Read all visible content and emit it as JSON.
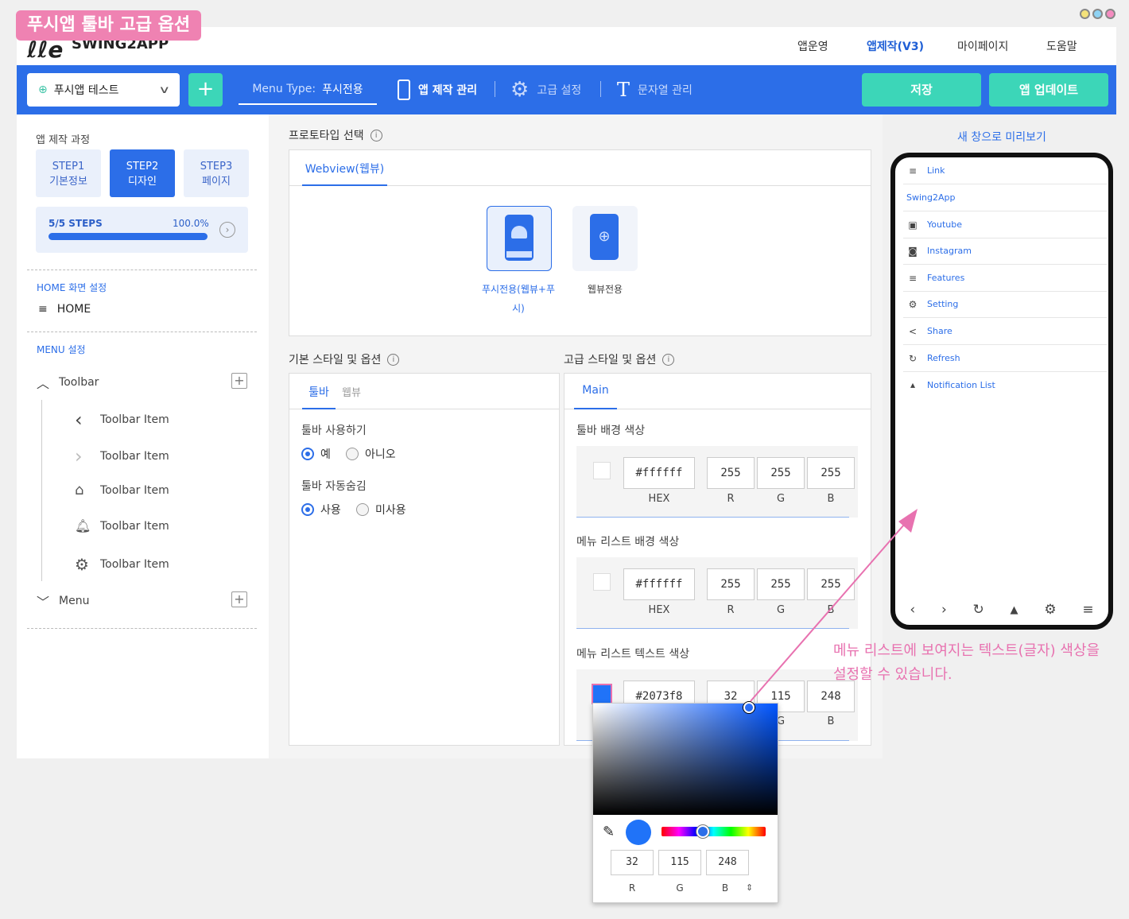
{
  "badge": "푸시앱 툴바 고급 옵션",
  "header": {
    "logo": "SWING2APP",
    "nav": [
      "앱운영",
      "앱제작(V3)",
      "마이페이지",
      "도움말"
    ]
  },
  "toolbar": {
    "app_name": "푸시앱 테스트",
    "plus": "+",
    "menu_type_label": "Menu Type:",
    "menu_type_value": "푸시전용",
    "app_manage": "앱 제작 관리",
    "advanced": "고급 설정",
    "strings": "문자열 관리",
    "save": "저장",
    "update": "앱 업데이트"
  },
  "sidebar": {
    "process_title": "앱 제작 과정",
    "steps": [
      {
        "top": "STEP1",
        "bottom": "기본정보"
      },
      {
        "top": "STEP2",
        "bottom": "디자인"
      },
      {
        "top": "STEP3",
        "bottom": "페이지"
      }
    ],
    "progress_label": "5/5 STEPS",
    "progress_value": "100.0%",
    "progress_fraction": 1.0,
    "home_title": "HOME 화면 설정",
    "home_item": "HOME",
    "menu_title": "MENU 설정",
    "toolbar_group": "Toolbar",
    "toolbar_items": [
      "Toolbar Item",
      "Toolbar Item",
      "Toolbar Item",
      "Toolbar Item",
      "Toolbar Item"
    ],
    "toolbar_item_icons": [
      "chevron-left-icon",
      "chevron-right-icon",
      "home-icon",
      "bell-icon",
      "gear-icon"
    ],
    "menu_group": "Menu"
  },
  "prototype": {
    "title": "프로토타입 선택",
    "tab": "Webview(웹뷰)",
    "card1_line1": "푸시전용(웹뷰+푸",
    "card1_line2": "시)",
    "card2": "웹뷰전용"
  },
  "basic": {
    "title": "기본 스타일 및 옵션",
    "tabs": [
      "툴바",
      "웹뷰"
    ],
    "q1": "툴바 사용하기",
    "q1_options": [
      "예",
      "아니오"
    ],
    "q2": "툴바 자동숨김",
    "q2_options": [
      "사용",
      "미사용"
    ]
  },
  "advanced": {
    "title": "고급 스타일 및 옵션",
    "tab": "Main",
    "rows": [
      {
        "label": "툴바 배경 색상",
        "hex": "#ffffff",
        "r": "255",
        "g": "255",
        "b": "255"
      },
      {
        "label": "메뉴 리스트 배경 색상",
        "hex": "#ffffff",
        "r": "255",
        "g": "255",
        "b": "255"
      },
      {
        "label": "메뉴 리스트 텍스트 색상",
        "hex": "#2073f8",
        "r": "32",
        "g": "115",
        "b": "248"
      }
    ],
    "lbl_hex": "HEX",
    "lbl_r": "R",
    "lbl_g": "G",
    "lbl_b": "B"
  },
  "preview": {
    "link": "새 창으로 미리보기",
    "menu": [
      "Link",
      "Swing2App",
      "Youtube",
      "Instagram",
      "Features",
      "Setting",
      "Share",
      "Refresh",
      "Notification List"
    ]
  },
  "annotation": {
    "line1": "메뉴 리스트에 보여지는 텍스트(글자) 색상을",
    "line2": "설정할 수 있습니다."
  },
  "picker": {
    "r": "32",
    "g": "115",
    "b": "248",
    "lbl_r": "R",
    "lbl_g": "G",
    "lbl_b": "B",
    "mode": "⇕"
  },
  "colors": {
    "accent": "#2c6ee8",
    "green": "#3cd6b8",
    "pink": "#ef82b2",
    "picked": "#2073f8"
  }
}
